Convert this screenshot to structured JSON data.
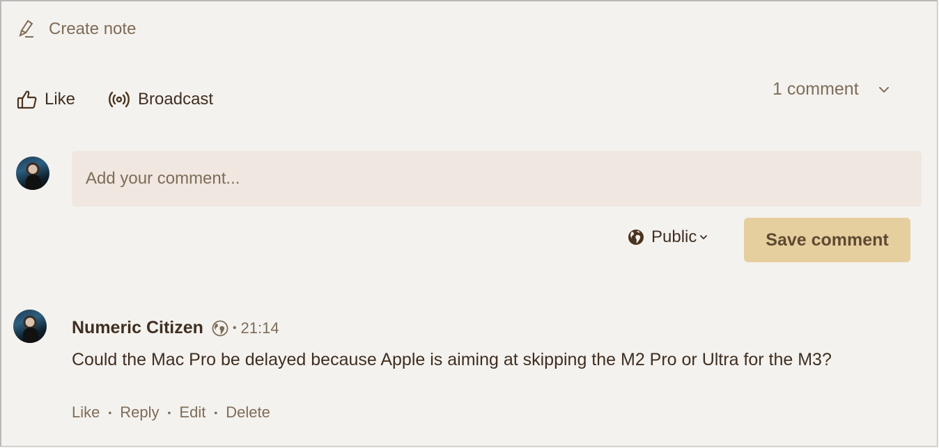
{
  "toolbar": {
    "create_note_label": "Create note",
    "create_note_icon": "highlighter-pen-icon"
  },
  "actions": {
    "like_label": "Like",
    "like_icon": "thumbs-up-icon",
    "broadcast_label": "Broadcast",
    "broadcast_icon": "broadcast-icon"
  },
  "comments_summary": {
    "count_label": "1 comment",
    "toggle_icon": "chevron-down-icon"
  },
  "composer": {
    "placeholder": "Add your comment...",
    "value": "",
    "visibility_label": "Public",
    "visibility_icon": "globe-icon",
    "save_label": "Save comment"
  },
  "comments": [
    {
      "author": "Numeric Citizen",
      "visibility_icon": "globe-icon",
      "separator": "•",
      "time": "21:14",
      "text": "Could the Mac Pro be delayed because Apple is aiming at skipping the M2 Pro or Ultra for the M3?",
      "actions": [
        "Like",
        "Reply",
        "Edit",
        "Delete"
      ],
      "action_separator": "•"
    }
  ],
  "colors": {
    "background": "#f4f2ee",
    "input_bg": "#efe7e0",
    "primary_button": "#e5cf9e",
    "text_dark": "#3f2f22",
    "text_muted": "#7d6c58"
  }
}
